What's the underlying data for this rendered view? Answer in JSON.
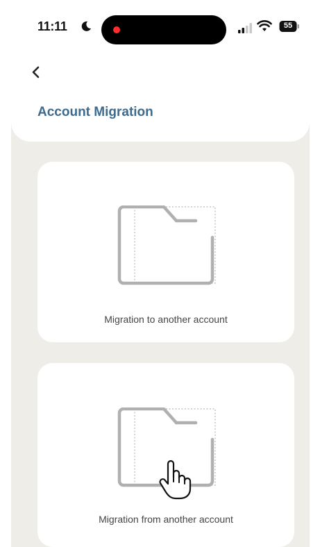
{
  "status_bar": {
    "time": "11:11",
    "battery": "55",
    "icons": [
      "moon-icon",
      "recording-dot-icon",
      "signal-icon",
      "wifi-icon",
      "battery-icon"
    ]
  },
  "header": {
    "back_icon": "chevron-left-icon",
    "title": "Account Migration"
  },
  "options": [
    {
      "label": "Migration to another account",
      "icon": "folder-icon"
    },
    {
      "label": "Migration from another account",
      "icon": "folder-icon"
    }
  ],
  "colors": {
    "title": "#3d6b8e",
    "background": "#eeede8",
    "card": "#ffffff",
    "icon_stroke": "#b0b0b0",
    "recording": "#ff2d2d"
  }
}
